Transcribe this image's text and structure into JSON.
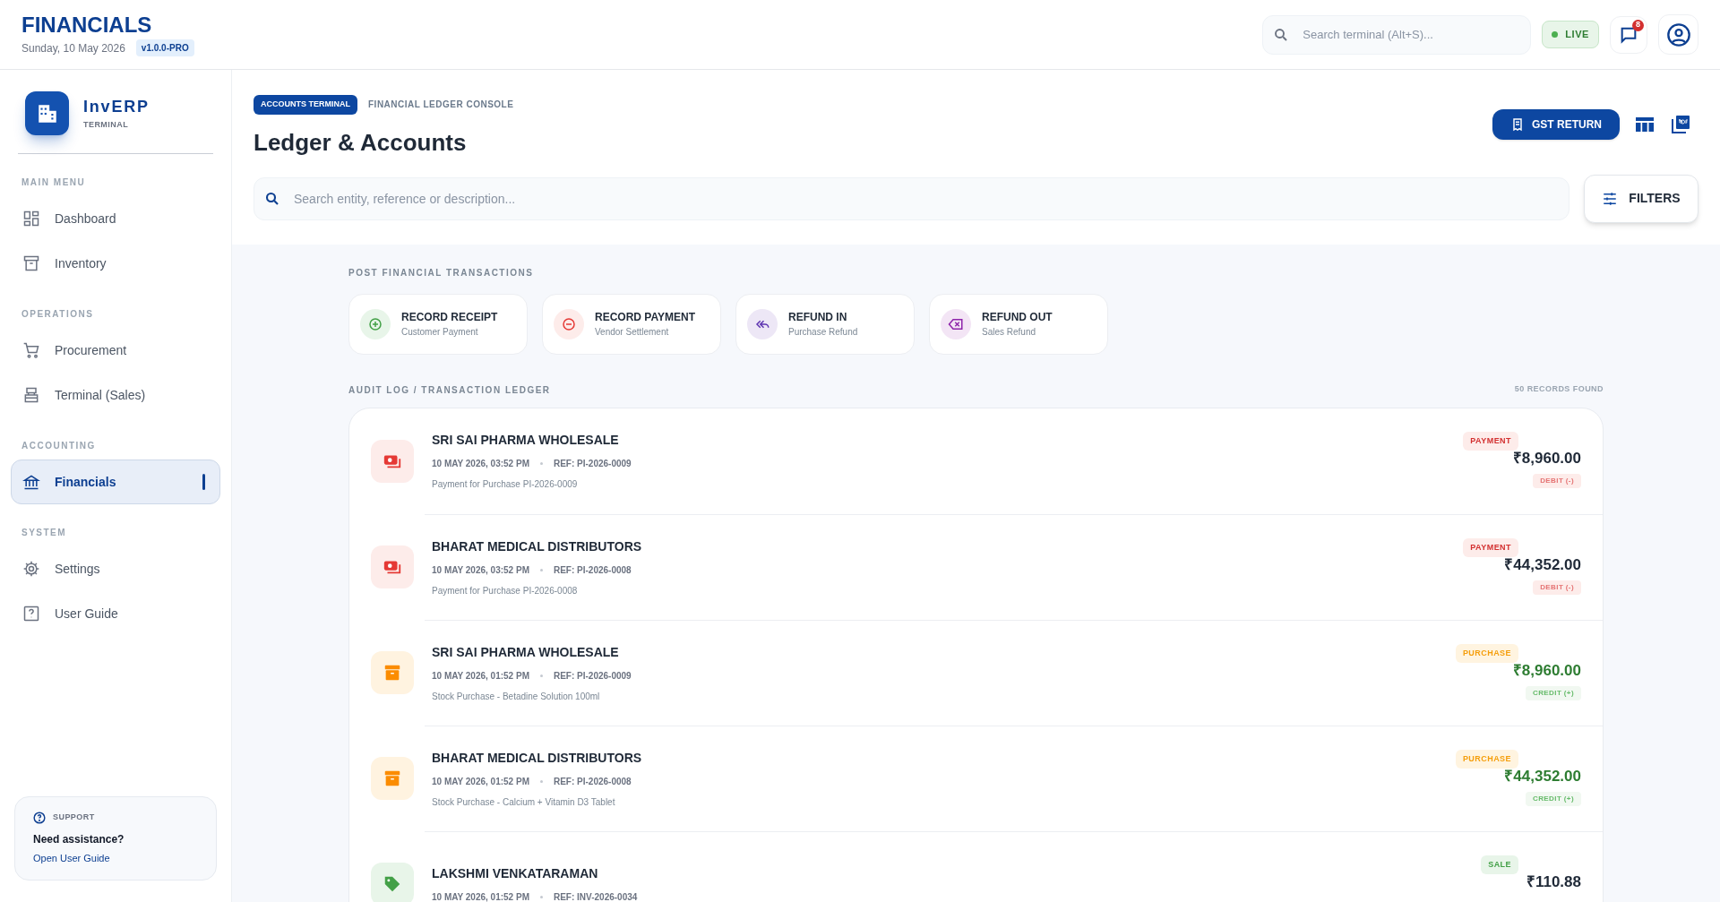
{
  "header": {
    "title": "FINANCIALS",
    "date": "Sunday, 10 May 2026",
    "version": "v1.0.0-PRO",
    "search": {
      "placeholder": "Search terminal (Alt+S)..."
    },
    "status": "LIVE",
    "notifications": "8"
  },
  "sidebar": {
    "brand": "InvERP",
    "brand_sub": "TERMINAL",
    "sections": [
      {
        "title": "MAIN MENU",
        "items": [
          {
            "label": "Dashboard",
            "selected": false
          },
          {
            "label": "Inventory",
            "selected": false
          }
        ]
      },
      {
        "title": "OPERATIONS",
        "items": [
          {
            "label": "Procurement",
            "selected": false
          },
          {
            "label": "Terminal (Sales)",
            "selected": false
          }
        ]
      },
      {
        "title": "ACCOUNTING",
        "items": [
          {
            "label": "Financials",
            "selected": true
          }
        ]
      },
      {
        "title": "SYSTEM",
        "items": [
          {
            "label": "Settings",
            "selected": false
          },
          {
            "label": "User Guide",
            "selected": false
          }
        ]
      }
    ],
    "support": {
      "title": "SUPPORT",
      "text": "Need assistance?",
      "link": "Open User Guide"
    }
  },
  "page": {
    "badge": "ACCOUNTS TERMINAL",
    "crumb": "FINANCIAL LEDGER CONSOLE",
    "title": "Ledger & Accounts",
    "gst_button": "GST RETURN",
    "search": {
      "placeholder": "Search entity, reference or description..."
    },
    "filters_button": "FILTERS"
  },
  "actions": {
    "title": "POST FINANCIAL TRANSACTIONS",
    "items": [
      {
        "kind": "receipt",
        "label": "RECORD RECEIPT",
        "sub": "Customer Payment"
      },
      {
        "kind": "payment",
        "label": "RECORD PAYMENT",
        "sub": "Vendor Settlement"
      },
      {
        "kind": "refund_in",
        "label": "REFUND IN",
        "sub": "Purchase Refund"
      },
      {
        "kind": "refund_out",
        "label": "REFUND OUT",
        "sub": "Sales Refund"
      }
    ]
  },
  "ledger": {
    "title": "AUDIT LOG / TRANSACTION LEDGER",
    "count": "50 RECORDS FOUND",
    "rows": [
      {
        "kind": "payment",
        "name": "SRI SAI PHARMA WHOLESALE",
        "time": "10 MAY 2026, 03:52 PM",
        "ref": "REF: PI-2026-0009",
        "description": "Payment for Purchase PI-2026-0009",
        "type": "PAYMENT",
        "amount": "₹8,960.00",
        "credit": false,
        "direction_label": "DEBIT (-)"
      },
      {
        "kind": "payment",
        "name": "BHARAT MEDICAL DISTRIBUTORS",
        "time": "10 MAY 2026, 03:52 PM",
        "ref": "REF: PI-2026-0008",
        "description": "Payment for Purchase PI-2026-0008",
        "type": "PAYMENT",
        "amount": "₹44,352.00",
        "credit": false,
        "direction_label": "DEBIT (-)"
      },
      {
        "kind": "purchase",
        "name": "SRI SAI PHARMA WHOLESALE",
        "time": "10 MAY 2026, 01:52 PM",
        "ref": "REF: PI-2026-0009",
        "description": "Stock Purchase - Betadine Solution 100ml",
        "type": "PURCHASE",
        "amount": "₹8,960.00",
        "credit": true,
        "direction_label": "CREDIT (+)"
      },
      {
        "kind": "purchase",
        "name": "BHARAT MEDICAL DISTRIBUTORS",
        "time": "10 MAY 2026, 01:52 PM",
        "ref": "REF: PI-2026-0008",
        "description": "Stock Purchase - Calcium + Vitamin D3 Tablet",
        "type": "PURCHASE",
        "amount": "₹44,352.00",
        "credit": true,
        "direction_label": "CREDIT (+)"
      },
      {
        "kind": "sale",
        "name": "LAKSHMI VENKATARAMAN",
        "time": "10 MAY 2026, 01:52 PM",
        "ref": "REF: INV-2026-0034",
        "type": "SALE",
        "amount": "₹110.88",
        "credit": false
      }
    ]
  }
}
